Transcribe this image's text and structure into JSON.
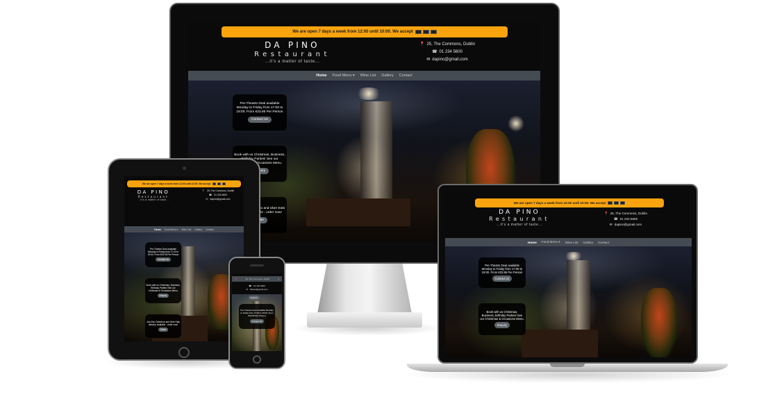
{
  "site": {
    "banner": "We are open 7 days a week from 12:00 until 10:00. We accept",
    "payment_icons": [
      "visa-card-icon",
      "mastercard-icon",
      "amex-card-icon"
    ],
    "brand_name": "DA PINO",
    "brand_sub": "Restaurant",
    "tagline": "...it's a matter of taste...",
    "address": "25, The Commons, Dublin",
    "phone": "01 234 5600",
    "email": "dapino@gmail.com",
    "nav": [
      {
        "label": "Home",
        "active": true
      },
      {
        "label": "Food Menu ▾",
        "active": false
      },
      {
        "label": "Wine List",
        "active": false
      },
      {
        "label": "Gallery",
        "active": false
      },
      {
        "label": "Contact",
        "active": false
      }
    ],
    "promos": [
      {
        "text": "Pre-Theatre Deal available Monday to Friday from 17:00 to 19:00. From €23.95 Per Person",
        "button": "Contact Us"
      },
      {
        "text": "Book with us Christmas, Business, Birthday Parties! See our Christmas & Occasions Menu.",
        "button": "Enquiry"
      },
      {
        "text": "Just Eat, Deliveroo and Uber Eats delivery available - order now!",
        "button": "Order"
      }
    ]
  },
  "colors": {
    "banner": "#f9a40f",
    "navbar": "#454b52",
    "page_bg": "#0a0a0a",
    "button": "#5c6268"
  }
}
